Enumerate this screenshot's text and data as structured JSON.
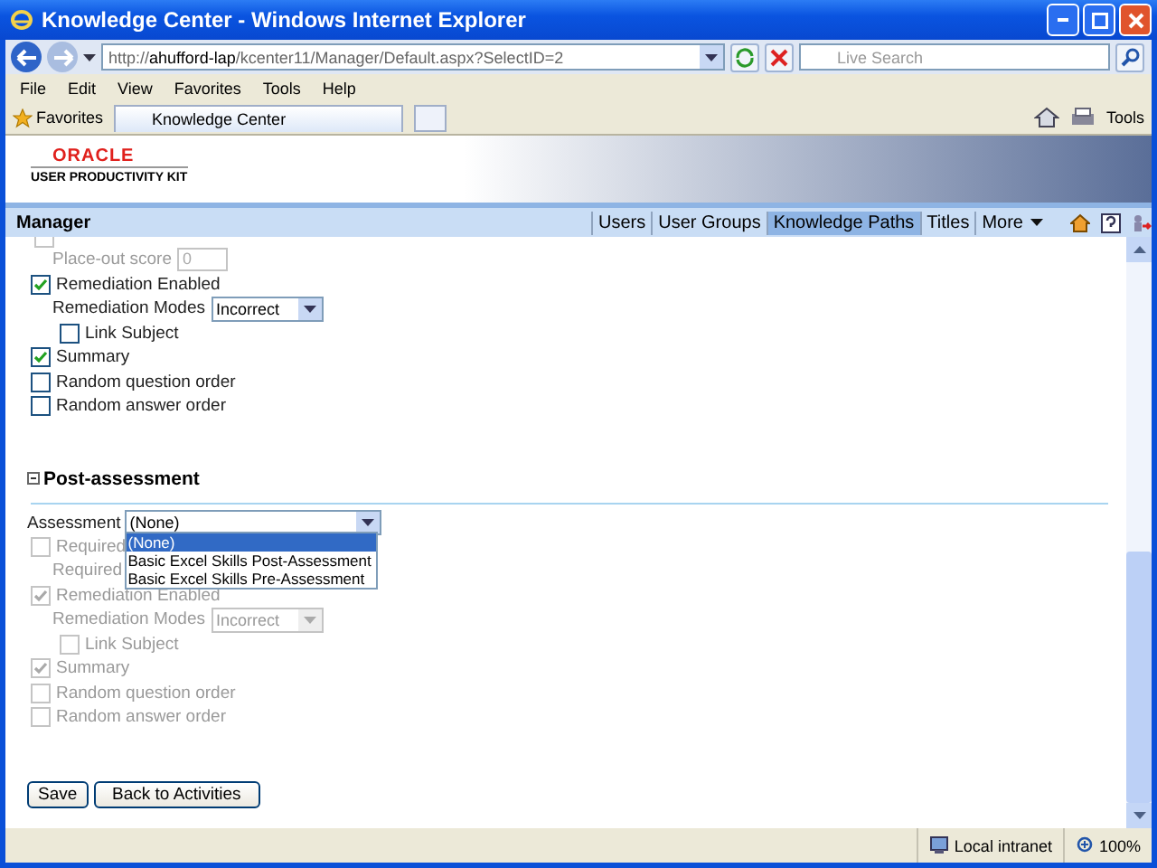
{
  "window": {
    "title": "Knowledge Center - Windows Internet Explorer"
  },
  "address_bar": {
    "url": "http://**ahufford-lap**/kcenter11/Manager/Default.aspx?SelectID=2",
    "search_placeholder": "Live Search"
  },
  "menu": [
    "File",
    "Edit",
    "View",
    "Favorites",
    "Tools",
    "Help"
  ],
  "favorites_bar": {
    "favorites": "Favorites",
    "tab": "Knowledge Center",
    "tools": "Tools"
  },
  "banner": {
    "logo": "ORACLE",
    "subtitle": "USER PRODUCTIVITY KIT"
  },
  "manager_bar": {
    "title": "Manager",
    "nav": [
      {
        "label": "Users",
        "selected": false
      },
      {
        "label": "User Groups",
        "selected": false
      },
      {
        "label": "Knowledge Paths",
        "selected": true
      },
      {
        "label": "Titles",
        "selected": false
      },
      {
        "label": "More",
        "selected": false
      }
    ]
  },
  "pre_assessment_rows": [
    {
      "kind": "clipped_checkbox",
      "checked": false,
      "disabled": true
    },
    {
      "kind": "field",
      "label": "Place-out score",
      "value": "0",
      "disabled": true
    },
    {
      "kind": "checkbox",
      "label": "Remediation Enabled",
      "checked": true,
      "disabled": false
    },
    {
      "kind": "select",
      "label": "Remediation Modes",
      "value": "Incorrect",
      "disabled": false
    },
    {
      "kind": "sub_checkbox",
      "label": "Link Subject",
      "checked": false,
      "disabled": false
    },
    {
      "kind": "checkbox",
      "label": "Summary",
      "checked": true,
      "disabled": false
    },
    {
      "kind": "checkbox",
      "label": "Random question order",
      "checked": false,
      "disabled": false
    },
    {
      "kind": "checkbox",
      "label": "Random answer order",
      "checked": false,
      "disabled": false
    }
  ],
  "post_assessment": {
    "heading": "Post-assessment",
    "expanded": true,
    "assessment": {
      "label": "Assessment",
      "value": "(None)",
      "open": true,
      "options": [
        {
          "label": "(None)",
          "selected": true
        },
        {
          "label": "Basic Excel Skills Post-Assessment",
          "selected": false
        },
        {
          "label": "Basic Excel Skills Pre-Assessment",
          "selected": false
        }
      ]
    },
    "rows": [
      {
        "kind": "checkbox",
        "label": "Required",
        "checked": false,
        "disabled": true
      },
      {
        "kind": "text",
        "label": "Required",
        "disabled": true
      },
      {
        "kind": "checkbox",
        "label": "Remediation Enabled",
        "checked": true,
        "disabled": true
      },
      {
        "kind": "select",
        "label": "Remediation Modes",
        "value": "Incorrect",
        "disabled": true
      },
      {
        "kind": "sub_checkbox",
        "label": "Link Subject",
        "checked": false,
        "disabled": true
      },
      {
        "kind": "checkbox",
        "label": "Summary",
        "checked": true,
        "disabled": true
      },
      {
        "kind": "checkbox",
        "label": "Random question order",
        "checked": false,
        "disabled": true
      },
      {
        "kind": "checkbox",
        "label": "Random answer order",
        "checked": false,
        "disabled": true
      }
    ]
  },
  "buttons": [
    "Save",
    "Back to Activities"
  ],
  "status_bar": {
    "zone": "Local intranet",
    "zoom": "100%"
  }
}
